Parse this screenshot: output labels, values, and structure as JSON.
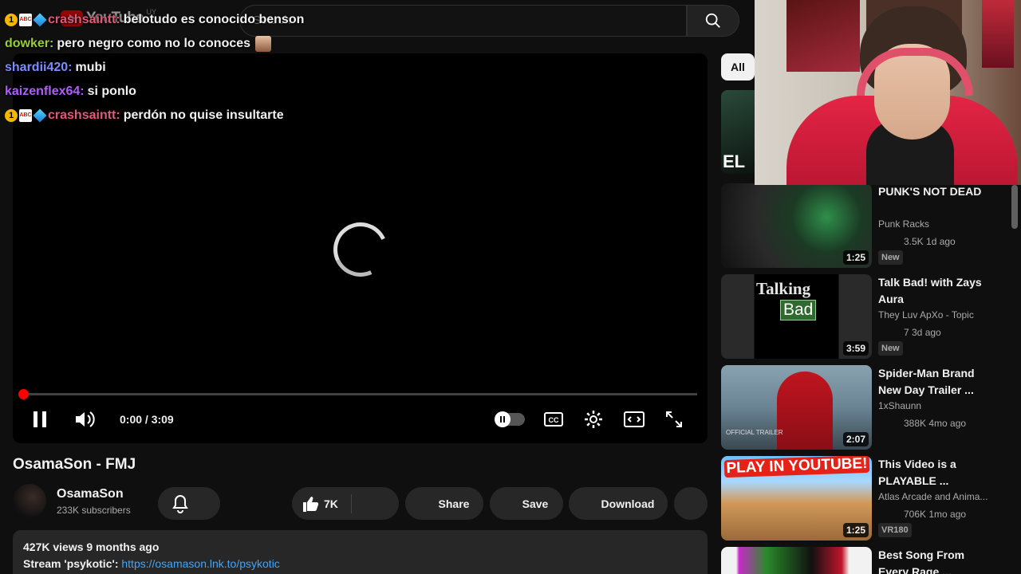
{
  "header": {
    "logo_text": "YouTube",
    "logo_country": "UY",
    "search_placeholder": "Search"
  },
  "chat": [
    {
      "user": "crashsaintt",
      "user_color": "#e05a78",
      "badges": true,
      "message": "belotudo es conocido benson",
      "emote": false
    },
    {
      "user": "dowker",
      "user_color": "#9acd32",
      "badges": false,
      "message": "pero negro como no lo conoces",
      "emote": true
    },
    {
      "user": "shardii420",
      "user_color": "#7b8cff",
      "badges": false,
      "message": "mubi",
      "emote": false
    },
    {
      "user": "kaizenflex64",
      "user_color": "#b05cff",
      "badges": false,
      "message": "si ponlo",
      "emote": false
    },
    {
      "user": "crashsaintt",
      "user_color": "#e05a78",
      "badges": true,
      "message": "perdón no quise insultarte",
      "emote": false
    }
  ],
  "player": {
    "time": "0:00 / 3:09",
    "progress": 0
  },
  "video": {
    "title": "OsamaSon - FMJ",
    "channel": "OsamaSon",
    "subscribers": "233K subscribers",
    "likes": "7K",
    "share_label": "Share",
    "save_label": "Save",
    "download_label": "Download",
    "views_date": "427K views  9 months ago",
    "desc_prefix": "Stream 'psykotic': ",
    "desc_link": "https://osamason.lnk.to/psykotic"
  },
  "sidebar": {
    "chip_all": "All",
    "first_thumb_text": "EL",
    "recommendations": [
      {
        "title": "PUNK'S NOT DEAD",
        "channel": "Punk Racks",
        "meta": "3.5K  1d ago",
        "badge": "New",
        "duration": "1:25"
      },
      {
        "title": "Talk Bad! with Zays Aura",
        "channel": "They Luv ApXo - Topic",
        "meta": "7  3d ago",
        "badge": "New",
        "duration": "3:59",
        "thumb_text_1": "Talking",
        "thumb_text_2": "Bad"
      },
      {
        "title": "Spider-Man Brand New Day Trailer ...",
        "channel": "1xShaunn",
        "meta": "388K  4mo ago",
        "badge": "",
        "duration": "2:07",
        "thumb_caption": "OFFICIAL TRAILER"
      },
      {
        "title": "This Video is a PLAYABLE ...",
        "channel": "Atlas Arcade and Anima...",
        "meta": "706K  1mo ago",
        "badge": "VR180",
        "duration": "1:25",
        "thumb_text_1": "PLAY IN YOUTUBE!"
      },
      {
        "title": "Best Song From Every Rage ...",
        "channel": "",
        "meta": "",
        "badge": "",
        "duration": ""
      }
    ]
  },
  "colors": {
    "background": "#0f0f0f",
    "progress_red": "#ff0000",
    "link_blue": "#3ea6ff"
  }
}
